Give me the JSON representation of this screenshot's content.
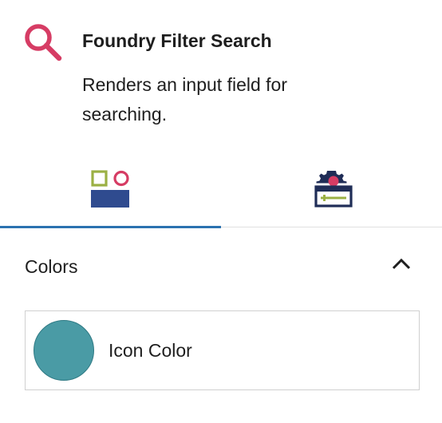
{
  "block": {
    "title": "Foundry Filter Search",
    "description": "Renders an input field for searching.",
    "icon": "search-icon",
    "icon_color": "#d63c64"
  },
  "tabs": [
    {
      "icon": "styles-icon",
      "active": true
    },
    {
      "icon": "settings-icon",
      "active": false
    }
  ],
  "panel": {
    "title": "Colors",
    "expanded": true,
    "toggle_icon": "chevron-up-icon"
  },
  "colors": [
    {
      "label": "Icon Color",
      "value": "#4a9ba5"
    }
  ],
  "accent": "#2b72b0"
}
